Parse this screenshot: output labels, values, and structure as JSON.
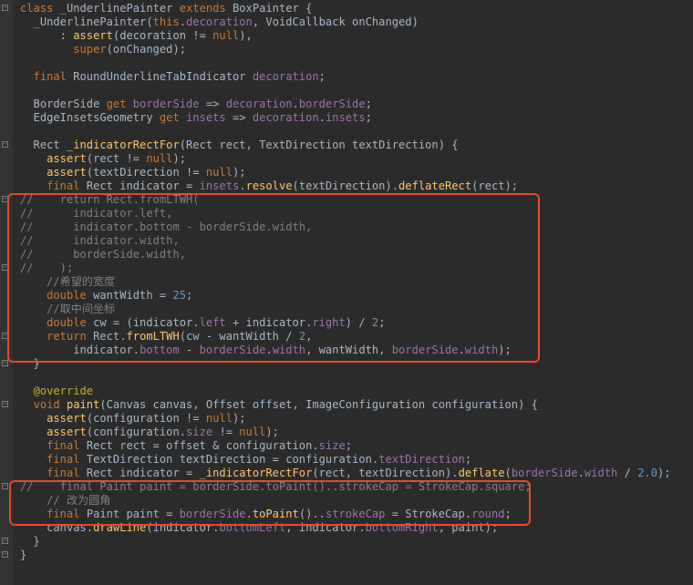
{
  "editor": {
    "theme_colors": {
      "background": "#2b2b2b",
      "keyword": "#cc7832",
      "function": "#ffc66d",
      "field": "#9876aa",
      "number": "#6897bb",
      "comment": "#808080",
      "annotation": "#bbb529",
      "text": "#a9b7c6",
      "highlight_border": "#e8492c"
    },
    "lines": [
      {
        "fold": "-",
        "segs": [
          [
            "k",
            "class "
          ],
          [
            "t",
            "_UnderlinePainter "
          ],
          [
            "k",
            "extends "
          ],
          [
            "t",
            "BoxPainter {"
          ]
        ]
      },
      {
        "segs": [
          [
            "t",
            "  _UnderlinePainter("
          ],
          [
            "k",
            "this"
          ],
          [
            "t",
            "."
          ],
          [
            "v",
            "decoration"
          ],
          [
            "t",
            ", VoidCallback onChanged)"
          ]
        ]
      },
      {
        "segs": [
          [
            "t",
            "      : "
          ],
          [
            "f",
            "assert"
          ],
          [
            "t",
            "(decoration != "
          ],
          [
            "k",
            "null"
          ],
          [
            "t",
            "),"
          ]
        ]
      },
      {
        "segs": [
          [
            "t",
            "        "
          ],
          [
            "k",
            "super"
          ],
          [
            "t",
            "(onChanged);"
          ]
        ]
      },
      {
        "segs": []
      },
      {
        "segs": [
          [
            "t",
            "  "
          ],
          [
            "k",
            "final "
          ],
          [
            "t",
            "RoundUnderlineTabIndicator "
          ],
          [
            "v",
            "decoration"
          ],
          [
            "t",
            ";"
          ]
        ]
      },
      {
        "segs": []
      },
      {
        "segs": [
          [
            "t",
            "  BorderSide "
          ],
          [
            "k",
            "get "
          ],
          [
            "v",
            "borderSide "
          ],
          [
            "t",
            "=> "
          ],
          [
            "v",
            "decoration"
          ],
          [
            "t",
            "."
          ],
          [
            "v",
            "borderSide"
          ],
          [
            "t",
            ";"
          ]
        ]
      },
      {
        "segs": [
          [
            "t",
            "  EdgeInsetsGeometry "
          ],
          [
            "k",
            "get "
          ],
          [
            "v",
            "insets "
          ],
          [
            "t",
            "=> "
          ],
          [
            "v",
            "decoration"
          ],
          [
            "t",
            "."
          ],
          [
            "v",
            "insets"
          ],
          [
            "t",
            ";"
          ]
        ]
      },
      {
        "segs": []
      },
      {
        "fold": "-",
        "segs": [
          [
            "t",
            "  Rect "
          ],
          [
            "f",
            "_indicatorRectFor"
          ],
          [
            "t",
            "(Rect rect, TextDirection textDirection) {"
          ]
        ]
      },
      {
        "segs": [
          [
            "t",
            "    "
          ],
          [
            "f",
            "assert"
          ],
          [
            "t",
            "(rect != "
          ],
          [
            "k",
            "null"
          ],
          [
            "t",
            ");"
          ]
        ]
      },
      {
        "segs": [
          [
            "t",
            "    "
          ],
          [
            "f",
            "assert"
          ],
          [
            "t",
            "(textDirection != "
          ],
          [
            "k",
            "null"
          ],
          [
            "t",
            ");"
          ]
        ]
      },
      {
        "segs": [
          [
            "t",
            "    "
          ],
          [
            "k",
            "final "
          ],
          [
            "t",
            "Rect indicator = "
          ],
          [
            "v",
            "insets"
          ],
          [
            "t",
            "."
          ],
          [
            "f",
            "resolve"
          ],
          [
            "t",
            "(textDirection)."
          ],
          [
            "f",
            "deflateRect"
          ],
          [
            "t",
            "(rect);"
          ]
        ]
      },
      {
        "fold": "-",
        "segs": [
          [
            "c",
            "//    return Rect.fromLTWH("
          ]
        ]
      },
      {
        "segs": [
          [
            "c",
            "//      indicator.left,"
          ]
        ]
      },
      {
        "segs": [
          [
            "c",
            "//      indicator.bottom - borderSide.width,"
          ]
        ]
      },
      {
        "segs": [
          [
            "c",
            "//      indicator.width,"
          ]
        ]
      },
      {
        "segs": [
          [
            "c",
            "//      borderSide.width,"
          ]
        ]
      },
      {
        "fold": "-",
        "segs": [
          [
            "c",
            "//    );"
          ]
        ]
      },
      {
        "segs": [
          [
            "c",
            "    //希望的宽度"
          ]
        ]
      },
      {
        "segs": [
          [
            "t",
            "    "
          ],
          [
            "k",
            "double "
          ],
          [
            "t",
            "wantWidth = "
          ],
          [
            "n",
            "25"
          ],
          [
            "t",
            ";"
          ]
        ]
      },
      {
        "segs": [
          [
            "c",
            "    //取中间坐标"
          ]
        ]
      },
      {
        "segs": [
          [
            "t",
            "    "
          ],
          [
            "k",
            "double "
          ],
          [
            "t",
            "cw = (indicator."
          ],
          [
            "v",
            "left "
          ],
          [
            "t",
            "+ indicator."
          ],
          [
            "v",
            "right"
          ],
          [
            "t",
            ") / "
          ],
          [
            "n",
            "2"
          ],
          [
            "t",
            ";"
          ]
        ]
      },
      {
        "fold": "-",
        "segs": [
          [
            "t",
            "    "
          ],
          [
            "k",
            "return "
          ],
          [
            "t",
            "Rect."
          ],
          [
            "f",
            "fromLTWH"
          ],
          [
            "t",
            "(cw - wantWidth / "
          ],
          [
            "n",
            "2"
          ],
          [
            "t",
            ","
          ]
        ]
      },
      {
        "segs": [
          [
            "t",
            "        indicator."
          ],
          [
            "v",
            "bottom "
          ],
          [
            "t",
            "- "
          ],
          [
            "v",
            "borderSide"
          ],
          [
            "t",
            "."
          ],
          [
            "v",
            "width"
          ],
          [
            "t",
            ", wantWidth, "
          ],
          [
            "v",
            "borderSide"
          ],
          [
            "t",
            "."
          ],
          [
            "v",
            "width"
          ],
          [
            "t",
            ");"
          ]
        ]
      },
      {
        "brace": true,
        "segs": [
          [
            "t",
            "  }"
          ]
        ]
      },
      {
        "segs": []
      },
      {
        "segs": [
          [
            "t",
            "  "
          ],
          [
            "a",
            "@override"
          ]
        ]
      },
      {
        "fold": "-",
        "segs": [
          [
            "t",
            "  "
          ],
          [
            "k",
            "void "
          ],
          [
            "f",
            "paint"
          ],
          [
            "t",
            "(Canvas canvas, Offset offset, ImageConfiguration configuration) {"
          ]
        ]
      },
      {
        "segs": [
          [
            "t",
            "    "
          ],
          [
            "f",
            "assert"
          ],
          [
            "t",
            "(configuration != "
          ],
          [
            "k",
            "null"
          ],
          [
            "t",
            ");"
          ]
        ]
      },
      {
        "segs": [
          [
            "t",
            "    "
          ],
          [
            "f",
            "assert"
          ],
          [
            "t",
            "(configuration."
          ],
          [
            "v",
            "size "
          ],
          [
            "t",
            "!= "
          ],
          [
            "k",
            "null"
          ],
          [
            "t",
            ");"
          ]
        ]
      },
      {
        "segs": [
          [
            "t",
            "    "
          ],
          [
            "k",
            "final "
          ],
          [
            "t",
            "Rect rect = offset & configuration."
          ],
          [
            "v",
            "size"
          ],
          [
            "t",
            ";"
          ]
        ]
      },
      {
        "segs": [
          [
            "t",
            "    "
          ],
          [
            "k",
            "final "
          ],
          [
            "t",
            "TextDirection textDirection = configuration."
          ],
          [
            "v",
            "textDirection"
          ],
          [
            "t",
            ";"
          ]
        ]
      },
      {
        "segs": [
          [
            "t",
            "    "
          ],
          [
            "k",
            "final "
          ],
          [
            "t",
            "Rect indicator = "
          ],
          [
            "f",
            "_indicatorRectFor"
          ],
          [
            "t",
            "(rect, textDirection)."
          ],
          [
            "f",
            "deflate"
          ],
          [
            "t",
            "("
          ],
          [
            "v",
            "borderSide"
          ],
          [
            "t",
            "."
          ],
          [
            "v",
            "width "
          ],
          [
            "t",
            "/ "
          ],
          [
            "n",
            "2.0"
          ],
          [
            "t",
            ");"
          ]
        ]
      },
      {
        "fold": "-",
        "segs": [
          [
            "c",
            "//    final Paint paint = borderSide.toPaint()..strokeCap = StrokeCap.square;"
          ]
        ]
      },
      {
        "segs": [
          [
            "c",
            "    // 改为圆角"
          ]
        ]
      },
      {
        "segs": [
          [
            "t",
            "    "
          ],
          [
            "k",
            "final "
          ],
          [
            "t",
            "Paint paint = "
          ],
          [
            "v",
            "borderSide"
          ],
          [
            "t",
            "."
          ],
          [
            "f",
            "toPaint"
          ],
          [
            "t",
            "().."
          ],
          [
            "v",
            "strokeCap "
          ],
          [
            "t",
            "= StrokeCap."
          ],
          [
            "v",
            "round"
          ],
          [
            "t",
            ";"
          ]
        ]
      },
      {
        "segs": [
          [
            "t",
            "    canvas."
          ],
          [
            "f",
            "drawLine"
          ],
          [
            "t",
            "(indicator."
          ],
          [
            "v",
            "bottomLeft"
          ],
          [
            "t",
            ", indicator."
          ],
          [
            "v",
            "bottomRight"
          ],
          [
            "t",
            ", paint);"
          ]
        ]
      },
      {
        "brace": true,
        "segs": [
          [
            "t",
            "  }"
          ]
        ]
      },
      {
        "brace": true,
        "segs": [
          [
            "t",
            "}"
          ]
        ]
      }
    ]
  }
}
